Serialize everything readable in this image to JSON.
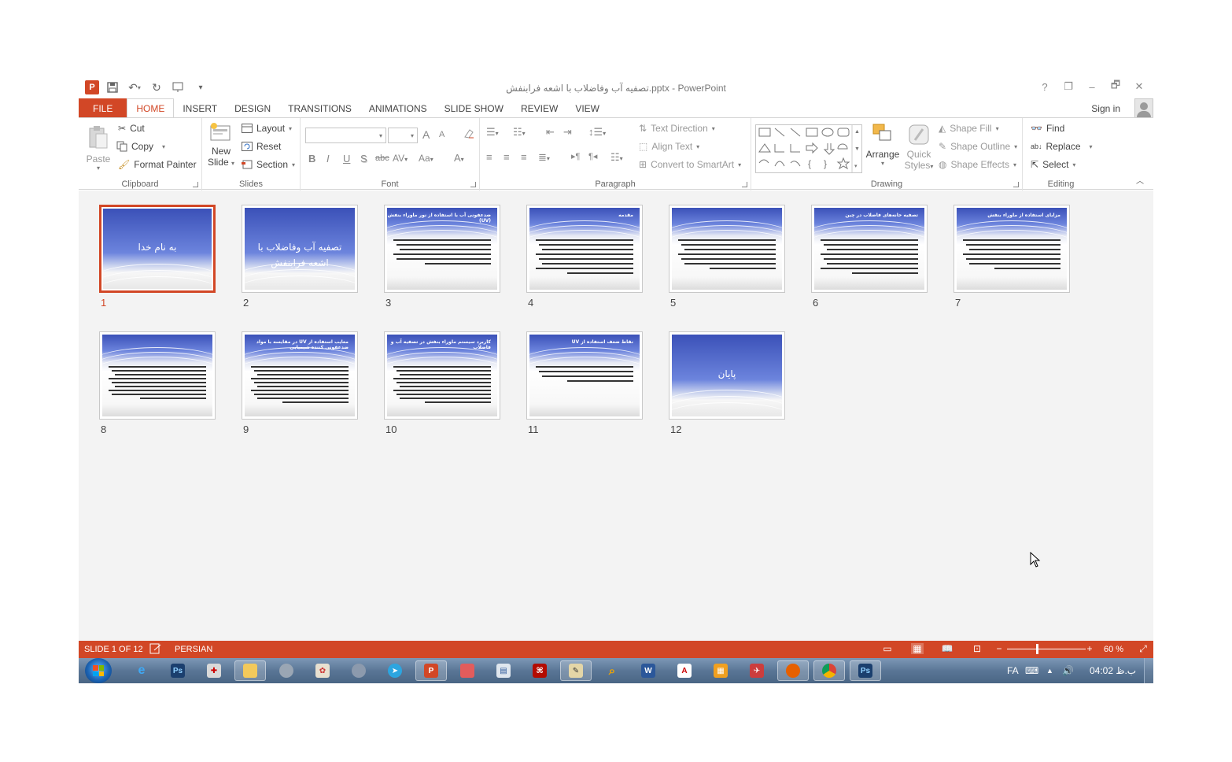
{
  "window": {
    "title": "تصفیه آب وفاضلاب با اشعه فرابنفش.pptx - PowerPoint",
    "controls": [
      "?",
      "❐",
      "–",
      "🗗",
      "✕"
    ]
  },
  "qat": {
    "app_icon": "P"
  },
  "tabs": [
    "FILE",
    "HOME",
    "INSERT",
    "DESIGN",
    "TRANSITIONS",
    "ANIMATIONS",
    "SLIDE SHOW",
    "REVIEW",
    "VIEW"
  ],
  "active_tab": "HOME",
  "signin": "Sign in",
  "ribbon": {
    "clipboard": {
      "label": "Clipboard",
      "paste": "Paste",
      "cut": "Cut",
      "copy": "Copy",
      "format_painter": "Format Painter"
    },
    "slides": {
      "label": "Slides",
      "new_slide_1": "New",
      "new_slide_2": "Slide",
      "layout": "Layout",
      "reset": "Reset",
      "section": "Section"
    },
    "font": {
      "label": "Font",
      "bold": "B",
      "italic": "I",
      "underline": "U",
      "shadow": "S",
      "strike": "abc",
      "spacing": "AV",
      "case": "Aa",
      "color": "A",
      "grow": "A",
      "shrink": "A"
    },
    "paragraph": {
      "label": "Paragraph",
      "text_direction": "Text Direction",
      "align_text": "Align Text",
      "convert": "Convert to SmartArt"
    },
    "drawing": {
      "label": "Drawing",
      "arrange": "Arrange",
      "quick_1": "Quick",
      "quick_2": "Styles",
      "fill": "Shape Fill",
      "outline": "Shape Outline",
      "effects": "Shape Effects"
    },
    "editing": {
      "label": "Editing",
      "find": "Find",
      "replace": "Replace",
      "select": "Select"
    }
  },
  "slides": [
    {
      "num": "1",
      "type": "title",
      "title": "به نام خدا",
      "selected": true
    },
    {
      "num": "2",
      "type": "title",
      "title": "تصفیه آب وفاضلاب با اشعه فرابنفش",
      "selected": false
    },
    {
      "num": "3",
      "type": "content",
      "title": "ضدعفونی آب با استفاده از نور ماوراء بنفش (UV)",
      "lines": 6,
      "selected": false
    },
    {
      "num": "4",
      "type": "content",
      "title": "مقدمه",
      "lines": 8,
      "selected": false
    },
    {
      "num": "5",
      "type": "content",
      "title": "",
      "lines": 7,
      "selected": false
    },
    {
      "num": "6",
      "type": "content",
      "title": "تصفیه خانه‌های فاضلاب در چین",
      "lines": 8,
      "selected": false
    },
    {
      "num": "7",
      "type": "content",
      "title": "مزایای استفاده از ماوراء بنفش",
      "lines": 7,
      "selected": false
    },
    {
      "num": "8",
      "type": "content",
      "title": "",
      "lines": 9,
      "selected": false
    },
    {
      "num": "9",
      "type": "content",
      "title": "معایب استفاده از UV در مقایسه با مواد ضدعفونی کننده شیمیایی",
      "lines": 10,
      "selected": false
    },
    {
      "num": "10",
      "type": "content",
      "title": "کاربرد سیستم ماوراء بنفش در تصفیه آب و فاضلاب",
      "lines": 10,
      "selected": false
    },
    {
      "num": "11",
      "type": "content",
      "title": "نقاط ضعف استفاده از UV",
      "lines": 4,
      "selected": false
    },
    {
      "num": "12",
      "type": "title",
      "title": "پایان",
      "selected": false
    }
  ],
  "status": {
    "slide_info": "SLIDE 1 OF 12",
    "language": "PERSIAN",
    "zoom": "60 %",
    "zoom_fraction": 0.37
  },
  "taskbar": {
    "lang": "FA",
    "clock": "04:02 ب.ظ"
  },
  "colors": {
    "accent": "#d24726",
    "slide_blue": "#3b51b8"
  }
}
